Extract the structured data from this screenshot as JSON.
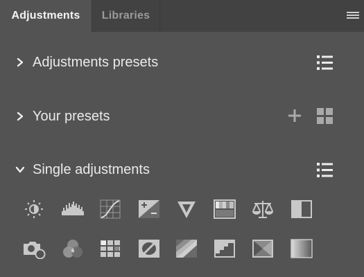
{
  "tabs": {
    "active": "Adjustments",
    "inactive": "Libraries"
  },
  "icons": {
    "panel_menu": "hamburger-icon",
    "collapse": "chevron-right-icon",
    "expand": "chevron-down-icon",
    "list": "list-view-icon",
    "add": "plus-icon",
    "grid": "grid-view-icon"
  },
  "sections": {
    "adjustments_presets": {
      "title": "Adjustments presets",
      "expanded": false
    },
    "your_presets": {
      "title": "Your presets",
      "expanded": false
    },
    "single_adjustments": {
      "title": "Single adjustments",
      "expanded": true
    }
  },
  "single_adjustments": [
    "brightness-contrast-icon",
    "levels-icon",
    "curves-icon",
    "exposure-icon",
    "vibrance-icon",
    "hue-saturation-icon",
    "color-balance-icon",
    "black-white-icon",
    "photo-filter-icon",
    "channel-mixer-icon",
    "color-lookup-icon",
    "invert-icon",
    "posterize-icon",
    "threshold-icon",
    "selective-color-icon",
    "gradient-map-icon"
  ],
  "colors": {
    "panel_bg": "#535353",
    "tabbar_bg": "#424242",
    "text": "#eaeaea",
    "icon": "#c8c8c8"
  }
}
